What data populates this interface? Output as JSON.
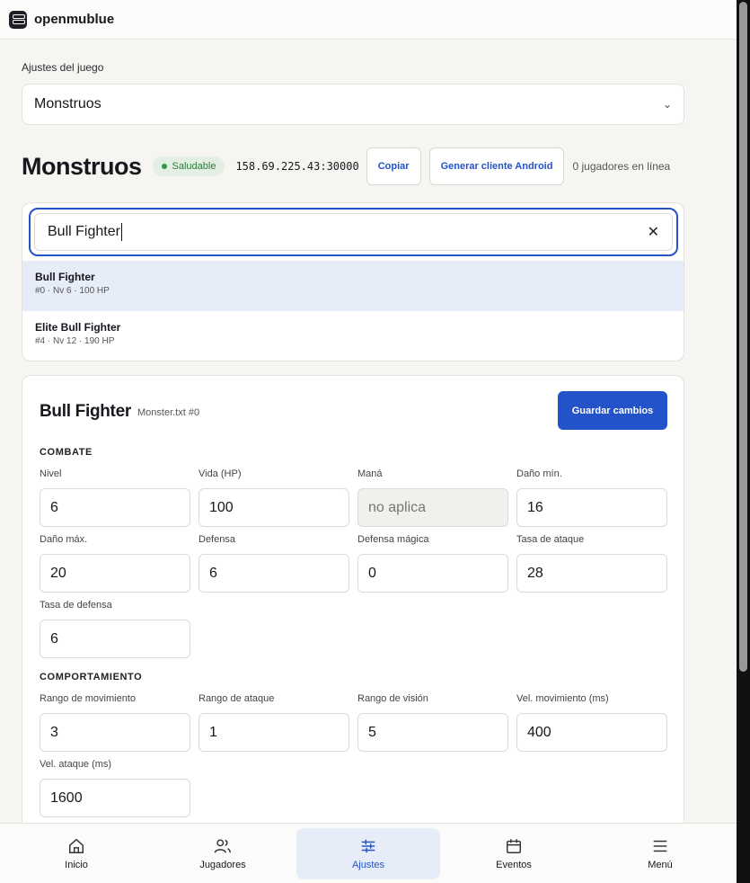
{
  "app": {
    "brand": "openmublue"
  },
  "settings": {
    "label": "Ajustes del juego",
    "selected": "Monstruos"
  },
  "header": {
    "title": "Monstruos",
    "status": "Saludable",
    "address": "158.69.225.43:30000",
    "copy_label": "Copiar",
    "android_label": "Generar cliente Android",
    "online": "0 jugadores en línea"
  },
  "search": {
    "value": "Bull Fighter",
    "results": [
      {
        "name": "Bull Fighter",
        "meta": "#0 · Nv 6 · 100 HP"
      },
      {
        "name": "Elite Bull Fighter",
        "meta": "#4 · Nv 12 · 190 HP"
      }
    ]
  },
  "editor": {
    "name": "Bull Fighter",
    "source": "Monster.txt #0",
    "save_label": "Guardar cambios",
    "combat": {
      "title": "COMBATE",
      "fields": [
        {
          "label": "Nivel",
          "value": "6"
        },
        {
          "label": "Vida (HP)",
          "value": "100"
        },
        {
          "label": "Maná",
          "value": "no aplica"
        },
        {
          "label": "Daño mín.",
          "value": "16"
        },
        {
          "label": "Daño máx.",
          "value": "20"
        },
        {
          "label": "Defensa",
          "value": "6"
        },
        {
          "label": "Defensa mágica",
          "value": "0"
        },
        {
          "label": "Tasa de ataque",
          "value": "28"
        },
        {
          "label": "Tasa de defensa",
          "value": "6"
        }
      ]
    },
    "behavior": {
      "title": "COMPORTAMIENTO",
      "fields": [
        {
          "label": "Rango de movimiento",
          "value": "3"
        },
        {
          "label": "Rango de ataque",
          "value": "1"
        },
        {
          "label": "Rango de visión",
          "value": "5"
        },
        {
          "label": "Vel. movimiento (ms)",
          "value": "400"
        },
        {
          "label": "Vel. ataque (ms)",
          "value": "1600"
        }
      ]
    }
  },
  "nav": [
    {
      "label": "Inicio",
      "icon": "home-icon"
    },
    {
      "label": "Jugadores",
      "icon": "users-icon"
    },
    {
      "label": "Ajustes",
      "icon": "sliders-icon"
    },
    {
      "label": "Eventos",
      "icon": "calendar-icon"
    },
    {
      "label": "Menú",
      "icon": "menu-icon"
    }
  ],
  "colors": {
    "accent": "#2452c9",
    "healthy": "#2f9a45",
    "background": "#f6f5f1"
  }
}
